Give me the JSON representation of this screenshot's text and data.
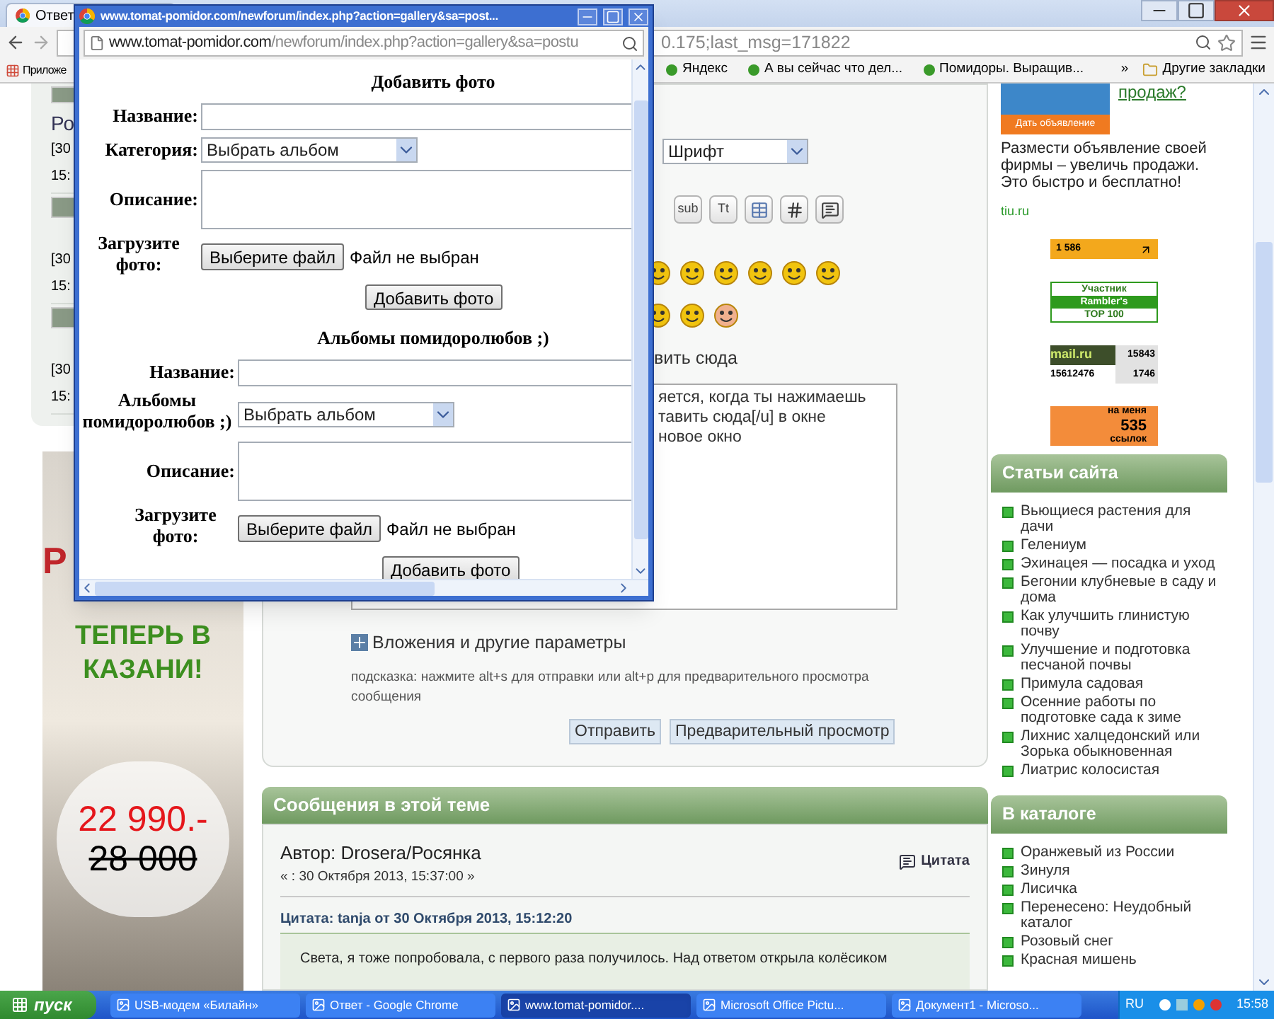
{
  "browser": {
    "tab": {
      "title": "Ответ"
    },
    "address_fragment": "0.175;last_msg=171822",
    "bookmarks": [
      {
        "label": "Приложе"
      },
      {
        "label": "Яндекс"
      },
      {
        "label": "А вы сейчас что дел..."
      },
      {
        "label": "Помидоры. Выращив..."
      }
    ],
    "more": "»",
    "other_bookmarks": "Другие закладки"
  },
  "popup": {
    "title": "www.tomat-pomidor.com/newforum/index.php?action=gallery&sa=post...",
    "url_domain": "www.tomat-pomidor.com",
    "url_path": "/newforum/index.php?action=gallery&sa=postu",
    "sections": [
      {
        "heading": "Добавить фото",
        "fields": [
          {
            "kind": "text",
            "label": "Название:"
          },
          {
            "kind": "select",
            "label": "Категория:",
            "value": "Выбрать альбом"
          },
          {
            "kind": "textarea",
            "label": "Описание:"
          },
          {
            "kind": "file",
            "label": "Загрузите фото:",
            "button": "Выберите файл",
            "status": "Файл не выбран"
          }
        ],
        "submit": "Добавить фото"
      },
      {
        "heading": "Альбомы помидоролюбов ;)",
        "fields": [
          {
            "kind": "text",
            "label": "Название:"
          },
          {
            "kind": "select",
            "label": "Альбомы помидоролюбов ;)",
            "value": "Выбрать альбом"
          },
          {
            "kind": "textarea",
            "label": "Описание:"
          },
          {
            "kind": "file",
            "label": "Загрузите фото:",
            "button": "Выберите файл",
            "status": "Файл не выбран"
          }
        ],
        "submit": "Добавить фото"
      }
    ]
  },
  "left": {
    "recent": [
      {
        "title": "Ро",
        "date": "[30",
        "time": "15:"
      },
      {
        "date": "[30",
        "time": "15:"
      },
      {
        "date": "[30",
        "time": "15:"
      }
    ],
    "ad": {
      "headline": "Р",
      "slogan": "ТЕПЕРЬ В КАЗАНИ!",
      "price": "22 990.-",
      "old_price": "28 000"
    }
  },
  "editor": {
    "font_select": "Шрифт",
    "format_buttons": [
      {
        "kind": "text",
        "label": "sub"
      },
      {
        "kind": "text",
        "label": "Tt"
      },
      {
        "kind": "table"
      },
      {
        "kind": "hash"
      },
      {
        "kind": "quote"
      }
    ],
    "insert_link": "вить сюда",
    "textarea_lines": [
      "яется, когда ты нажимаешь",
      "тавить сюда[/u] в окне",
      "новое окно"
    ],
    "attachments": "Вложения и другие параметры",
    "hint": "подсказка: нажмите alt+s для отправки или alt+p для предварительного просмотра сообщения",
    "buttons": [
      "Отправить",
      "Предварительный просмотр"
    ]
  },
  "messages": {
    "header": "Сообщения в этой теме",
    "author": "Автор: Drosera/Росянка",
    "date": "« : 30 Октября 2013, 15:37:00 »",
    "quote_button": "Цитата",
    "quote_header": "Цитата: tanja от 30 Октября 2013, 15:12:20",
    "quote_text": "Света, я тоже попробовала, с первого раза получилось. Над ответом открыла колёсиком"
  },
  "right": {
    "ad": {
      "title": "продаж?",
      "button": "Дать объявление",
      "text": "Размести объявление своей фирмы – увеличь продажи. Это быстро и бесплатно!",
      "source": "tiu.ru"
    },
    "counters": [
      {
        "kind": "liveinternet",
        "texts": [
          "1 586"
        ]
      },
      {
        "kind": "rambler",
        "texts": [
          "Участник",
          "Rambler's",
          "TOP 100"
        ]
      },
      {
        "kind": "mail",
        "texts": [
          "mail.ru",
          "15843",
          "15612476",
          "1746"
        ]
      },
      {
        "kind": "yandex",
        "texts": [
          "на меня",
          "535",
          "ссылок"
        ]
      }
    ],
    "articles": {
      "heading": "Статьи сайта",
      "items": [
        "Вьющиеся растения для дачи",
        "Гелениум",
        "Эхинацея — посадка и уход",
        "Бегонии клубневые в саду и дома",
        "Как улучшить глинистую почву",
        "Улучшение и подготовка песчаной почвы",
        "Примула садовая",
        "Осенние работы по подготовке сада к зиме",
        "Лихнис халцедонский или Зорька обыкновенная",
        "Лиатрис колосистая"
      ]
    },
    "catalog": {
      "heading": "В каталоге",
      "items": [
        "Оранжевый из России",
        "Зинуля",
        "Лисичка",
        "Перенесено: Неудобный каталог",
        "Розовый снег",
        "Красная мишень"
      ]
    }
  },
  "taskbar": {
    "start": "пуск",
    "tasks": [
      {
        "label": "USB-модем «Билайн»",
        "selected": false
      },
      {
        "label": "Ответ - Google Chrome",
        "selected": false
      },
      {
        "label": "www.tomat-pomidor....",
        "selected": true
      },
      {
        "label": "Microsoft Office Pictu...",
        "selected": false
      },
      {
        "label": "Документ1 - Microso...",
        "selected": false
      }
    ],
    "language": "RU",
    "time": "15:58"
  }
}
